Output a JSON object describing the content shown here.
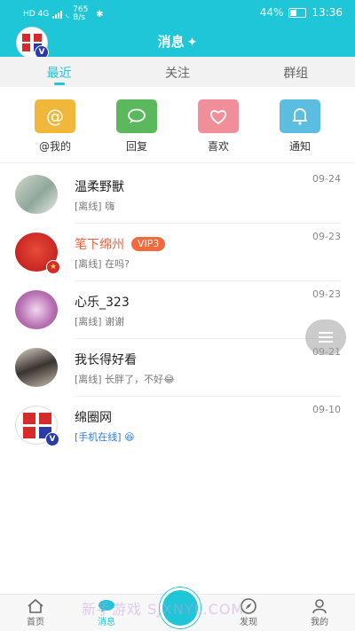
{
  "status_bar": {
    "left_text": "HD 4G",
    "speed": "765 B/s",
    "battery": "44%",
    "time": "13:36"
  },
  "header": {
    "title": "消息",
    "avatar_icon": "site-logo-avatar",
    "clean_icon": "broom-icon"
  },
  "tabs": [
    {
      "label": "最近",
      "active": true
    },
    {
      "label": "关注",
      "active": false
    },
    {
      "label": "群组",
      "active": false
    }
  ],
  "quick_actions": [
    {
      "label": "@我的",
      "icon": "at-icon",
      "color": "#f0b73a"
    },
    {
      "label": "回复",
      "icon": "chat-bubble-icon",
      "color": "#5cb85c"
    },
    {
      "label": "喜欢",
      "icon": "heart-icon",
      "color": "#f08f9a"
    },
    {
      "label": "通知",
      "icon": "bell-icon",
      "color": "#5bbde0"
    }
  ],
  "conversations": [
    {
      "name": "温柔野獸",
      "preview": "[离线] 嗨",
      "time": "09-24",
      "vip": ""
    },
    {
      "name": "笔下绵州",
      "preview": "[离线] 在吗?",
      "time": "09-23",
      "vip": "VIP3"
    },
    {
      "name": "心乐_323",
      "preview": "[离线] 谢谢",
      "time": "09-23",
      "vip": ""
    },
    {
      "name": "我长得好看",
      "preview": "[离线] 长胖了，不好😂",
      "time": "09-21",
      "vip": ""
    },
    {
      "name": "绵圈网",
      "preview": "[手机在线] 😆",
      "time": "09-10",
      "vip": ""
    }
  ],
  "bottom_nav": [
    {
      "label": "首页",
      "icon": "home-icon"
    },
    {
      "label": "消息",
      "icon": "message-icon"
    },
    {
      "label": "",
      "icon": "post-icon"
    },
    {
      "label": "发现",
      "icon": "compass-icon"
    },
    {
      "label": "我的",
      "icon": "user-icon"
    }
  ],
  "watermark": "新手游戏 SJXNYL.COM",
  "colors": {
    "accent": "#1ec6d8",
    "vip": "#f06a3e",
    "online": "#2a7de1"
  }
}
